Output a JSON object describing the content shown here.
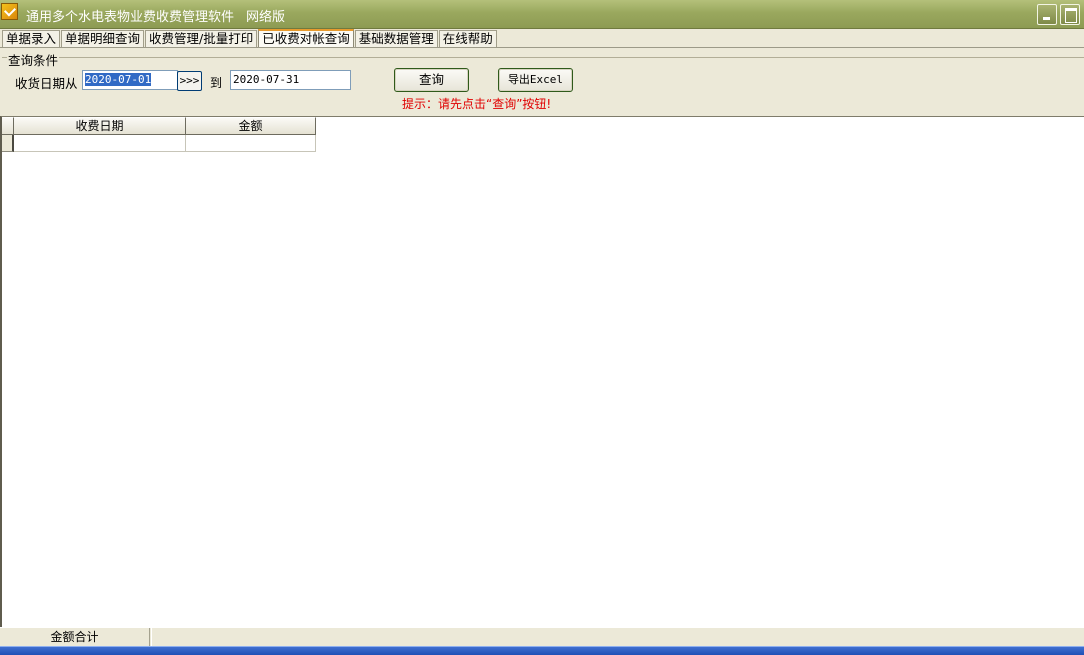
{
  "window": {
    "title": "通用多个水电表物业费收费管理软件",
    "edition": "网络版"
  },
  "tabs": [
    {
      "label": "单据录入",
      "active": false
    },
    {
      "label": "单据明细查询",
      "active": false
    },
    {
      "label": "收费管理/批量打印",
      "active": false
    },
    {
      "label": "已收费对帐查询",
      "active": true
    },
    {
      "label": "基础数据管理",
      "active": false
    },
    {
      "label": "在线帮助",
      "active": false
    }
  ],
  "query": {
    "group_label": "查询条件",
    "from_label": "收货日期从",
    "date_from": "2020-07-01",
    "arrow_label": ">>>",
    "to_label": "到",
    "date_to": "2020-07-31",
    "query_button": "查询",
    "export_button": "导出Excel",
    "hint": "提示：请先点击“查询”按钮!"
  },
  "grid": {
    "columns": [
      "收费日期",
      "金额"
    ],
    "rows": [
      [
        "",
        ""
      ]
    ]
  },
  "footer": {
    "total_label": "金额合计",
    "total_value": ""
  },
  "colors": {
    "titlebar": "#9aa85e",
    "hint": "#e00000",
    "selection": "#316ac5",
    "active_tab_accent": "#e79a2d"
  }
}
